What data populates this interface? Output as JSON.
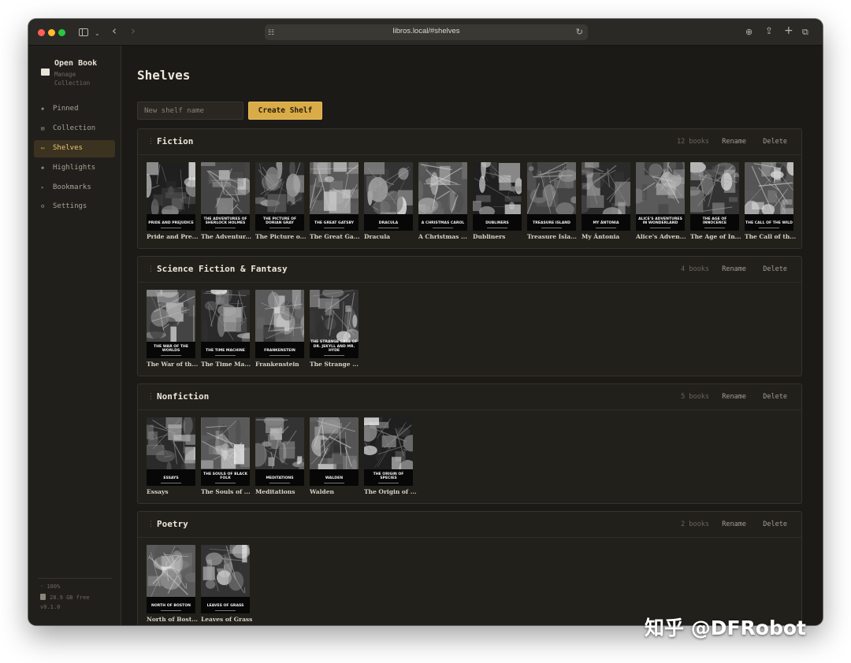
{
  "browser": {
    "url": "libros.local/#shelves",
    "back_icon": "chevron-left-icon",
    "forward_icon": "chevron-right-icon"
  },
  "sidebar": {
    "brand_name": "Open Book",
    "brand_subtitle": "Manage Collection",
    "items": [
      {
        "label": "Pinned",
        "icon": "pin-icon",
        "active": false
      },
      {
        "label": "Collection",
        "icon": "grid-icon",
        "active": false
      },
      {
        "label": "Shelves",
        "icon": "shelves-icon",
        "active": true
      },
      {
        "label": "Highlights",
        "icon": "highlight-icon",
        "active": false
      },
      {
        "label": "Bookmarks",
        "icon": "bookmark-icon",
        "active": false
      },
      {
        "label": "Settings",
        "icon": "gear-icon",
        "active": false
      }
    ],
    "footer": {
      "zoom": "100%",
      "storage": "28.9 GB free",
      "version": "v0.1.0"
    }
  },
  "main": {
    "title": "Shelves",
    "new_shelf_placeholder": "New shelf name",
    "create_label": "Create Shelf",
    "rename_label": "Rename",
    "delete_label": "Delete"
  },
  "shelves": [
    {
      "name": "Fiction",
      "count": "12 books",
      "books": [
        {
          "cover": "PRIDE AND PREJUDICE",
          "caption": "Pride and Pre..."
        },
        {
          "cover": "THE ADVENTURES OF SHERLOCK HOLMES",
          "caption": "The Adventur..."
        },
        {
          "cover": "THE PICTURE OF DORIAN GRAY",
          "caption": "The Picture o..."
        },
        {
          "cover": "THE GREAT GATSBY",
          "caption": "The Great Ga..."
        },
        {
          "cover": "DRACULA",
          "caption": "Dracula"
        },
        {
          "cover": "A CHRISTMAS CAROL",
          "caption": "A Christmas ..."
        },
        {
          "cover": "DUBLINERS",
          "caption": "Dubliners"
        },
        {
          "cover": "TREASURE ISLAND",
          "caption": "Treasure Isla..."
        },
        {
          "cover": "MY ÁNTONIA",
          "caption": "My Ántonia"
        },
        {
          "cover": "ALICE'S ADVENTURES IN WONDERLAND",
          "caption": "Alice's Adven..."
        },
        {
          "cover": "THE AGE OF INNOCENCE",
          "caption": "The Age of In..."
        },
        {
          "cover": "THE CALL OF THE WILD",
          "caption": "The Call of th..."
        }
      ]
    },
    {
      "name": "Science Fiction & Fantasy",
      "count": "4 books",
      "books": [
        {
          "cover": "THE WAR OF THE WORLDS",
          "caption": "The War of th..."
        },
        {
          "cover": "THE TIME MACHINE",
          "caption": "The Time Ma..."
        },
        {
          "cover": "FRANKENSTEIN",
          "caption": "Frankenstein"
        },
        {
          "cover": "THE STRANGE CASE OF DR. JEKYLL AND MR. HYDE",
          "caption": "The Strange ..."
        }
      ]
    },
    {
      "name": "Nonfiction",
      "count": "5 books",
      "books": [
        {
          "cover": "ESSAYS",
          "caption": "Essays"
        },
        {
          "cover": "THE SOULS OF BLACK FOLK",
          "caption": "The Souls of ..."
        },
        {
          "cover": "MEDITATIONS",
          "caption": "Meditations"
        },
        {
          "cover": "WALDEN",
          "caption": "Walden"
        },
        {
          "cover": "THE ORIGIN OF SPECIES",
          "caption": "The Origin of ..."
        }
      ]
    },
    {
      "name": "Poetry",
      "count": "2 books",
      "books": [
        {
          "cover": "NORTH OF BOSTON",
          "caption": "North of Bost..."
        },
        {
          "cover": "LEAVES OF GRASS",
          "caption": "Leaves of Grass"
        }
      ]
    }
  ],
  "watermark": "知乎 @DFRobot"
}
